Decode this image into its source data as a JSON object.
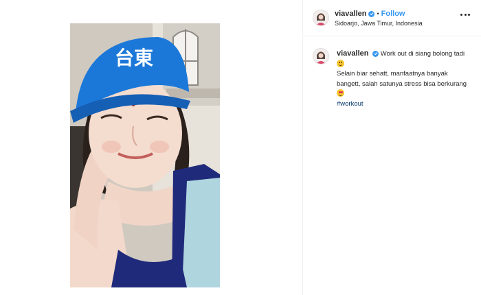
{
  "post": {
    "username": "viavallen",
    "verified": true,
    "follow_label": "Follow",
    "separator": "•",
    "location": "Sidoarjo, Jawa Timur, Indonesia"
  },
  "caption": {
    "username": "viavallen",
    "line1": "Work out di siang bolong tadi",
    "line2": "Selain biar sehatt, manfaatnya banyak bangett, salah satunya stress bisa berkurang",
    "hashtag": "#workout"
  },
  "photo": {
    "cap_text": "台東"
  },
  "colors": {
    "link_blue": "#3897f0",
    "hashtag_blue": "#003569",
    "verified_blue": "#3897f0",
    "cap_blue": "#1a6fd0"
  },
  "icons": {
    "more": "more-options-icon",
    "verified": "verified-badge-icon",
    "emoji_grin": "grinning-emoji-icon",
    "emoji_heart": "heart-eyes-emoji-icon"
  }
}
